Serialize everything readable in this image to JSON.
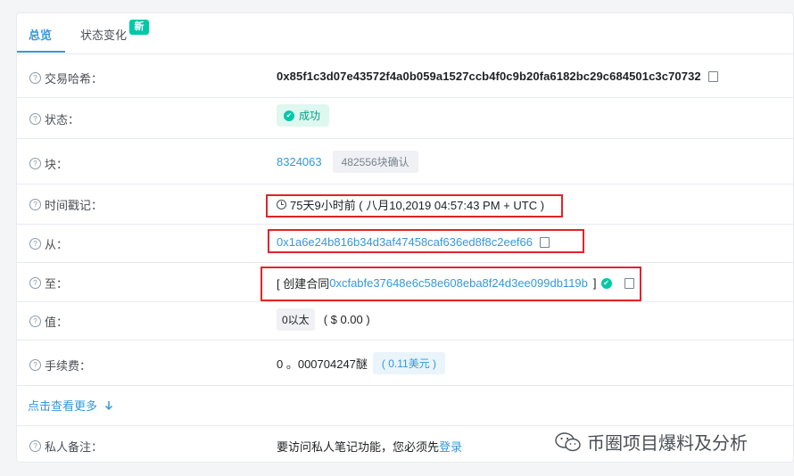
{
  "tabs": [
    {
      "label": "总览"
    },
    {
      "label": "状态变化"
    }
  ],
  "new_badge": "新",
  "rows": {
    "hash": {
      "label": "交易哈希：",
      "value": "0x85f1c3d07e43572f4a0b059a1527ccb4f0c9b20fa6182bc29c684501c3c70732"
    },
    "status": {
      "label": "状态：",
      "value": "成功"
    },
    "block": {
      "label": "块：",
      "value": "8324063",
      "confirmations": "482556块确认"
    },
    "timestamp": {
      "label": "时间戳记：",
      "value": "75天9小时前 ( 八月10,2019 04:57:43 PM + UTC )"
    },
    "from": {
      "label": "从：",
      "value": "0x1a6e24b816b34d3af47458caf636ed8f8c2eef66"
    },
    "to": {
      "label": "至：",
      "prefix": "[ 创建合同",
      "address": "0xcfabfe37648e6c58e608eba8f24d3ee099db119b",
      "suffix": "]"
    },
    "value": {
      "label": "值：",
      "amount": "0以太",
      "usd": "( $ 0.00 )"
    },
    "fee": {
      "label": "手续费：",
      "amount": "0 。000704247醚",
      "usd": "( 0.11美元 )"
    },
    "note": {
      "label": "私人备注：",
      "text": "要访问私人笔记功能，您必须先",
      "login": "登录"
    }
  },
  "more_link": "点击查看更多",
  "watermark": "币圈项目爆料及分析",
  "colors": {
    "accent": "#3498db",
    "success": "#00c9a7",
    "highlight": "#e0242b"
  }
}
